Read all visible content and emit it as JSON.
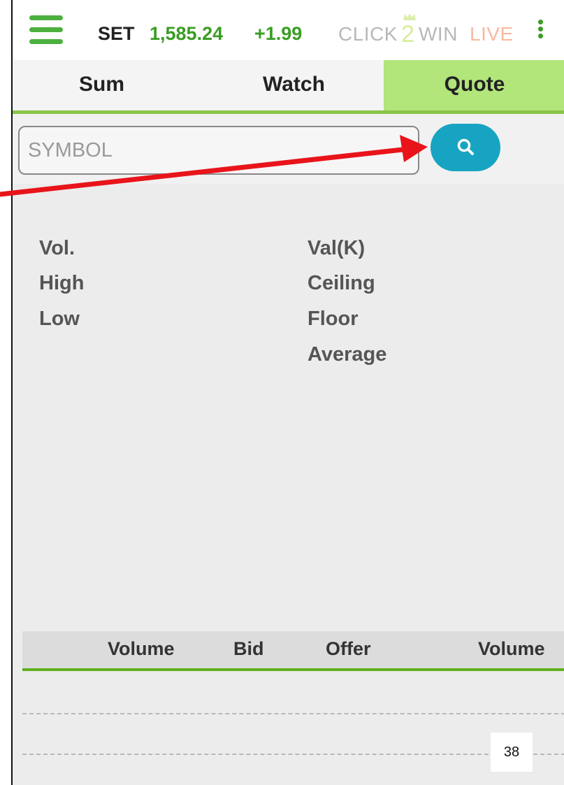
{
  "header": {
    "index_name": "SET",
    "index_value": "1,585.24",
    "index_change": "+1.99",
    "logo": {
      "part1": "CLICK",
      "part2": "2",
      "part3": "WIN",
      "part4": "LIVE"
    },
    "menu_icon": "hamburger-menu-icon",
    "more_icon": "kebab-menu-icon"
  },
  "tabs": [
    {
      "label": "Sum",
      "active": false
    },
    {
      "label": "Watch",
      "active": false
    },
    {
      "label": "Quote",
      "active": true
    }
  ],
  "search": {
    "placeholder": "SYMBOL",
    "value": "",
    "button_icon": "search-icon"
  },
  "quote": {
    "left": [
      "Vol.",
      "High",
      "Low"
    ],
    "right": [
      "Val(K)",
      "Ceiling",
      "Floor",
      "Average"
    ]
  },
  "order_book": {
    "columns": [
      "Volume",
      "Bid",
      "Offer",
      "Volume"
    ]
  },
  "page_number": "38",
  "colors": {
    "accent_green": "#3a9d23",
    "active_tab": "#b2e57a",
    "search_button": "#17a4c2",
    "annotation_arrow": "#e8141a"
  }
}
